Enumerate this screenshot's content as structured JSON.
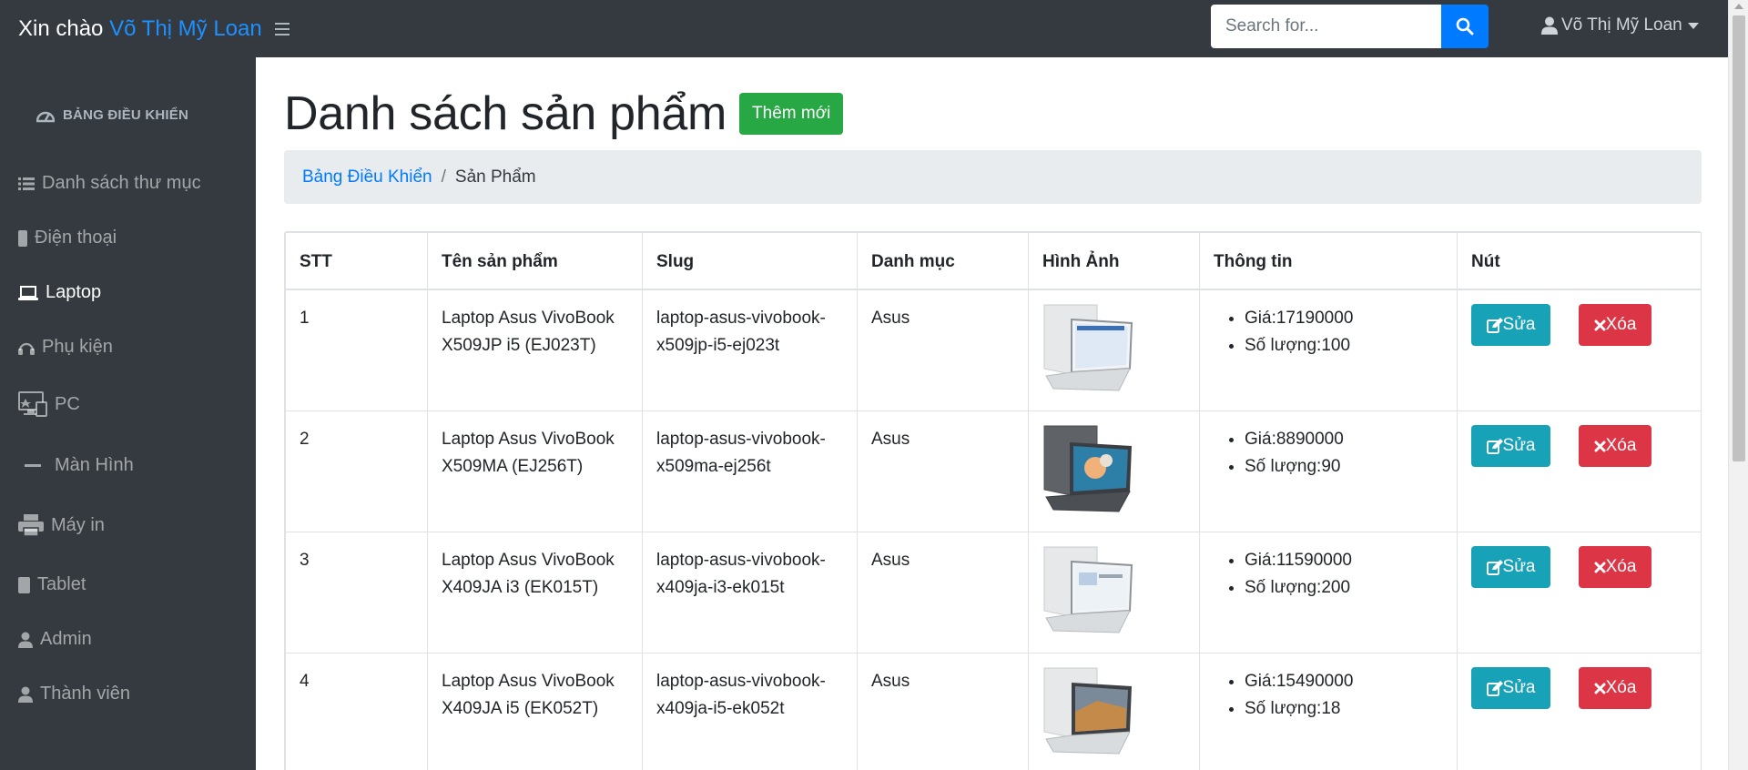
{
  "navbar": {
    "greeting": "Xin chào",
    "user_name": "Võ Thị Mỹ Loan",
    "search_placeholder": "Search for...",
    "user_menu_label": "Võ Thị Mỹ Loan"
  },
  "sidebar": {
    "heading": "BẢNG ĐIỀU KHIỂN",
    "items": [
      {
        "label": "Danh sách thư mục",
        "icon": "list-icon"
      },
      {
        "label": "Điện thoại",
        "icon": "mobile-icon"
      },
      {
        "label": "Laptop",
        "icon": "laptop-icon",
        "active": true
      },
      {
        "label": "Phụ kiện",
        "icon": "headphones-icon"
      },
      {
        "label": "PC",
        "icon": "desktop-icon"
      },
      {
        "label": "Màn Hình",
        "icon": "minus-icon"
      },
      {
        "label": "Máy in",
        "icon": "printer-icon"
      },
      {
        "label": "Tablet",
        "icon": "tablet-icon"
      },
      {
        "label": "Admin",
        "icon": "user-icon"
      },
      {
        "label": "Thành viên",
        "icon": "user-icon"
      }
    ]
  },
  "page": {
    "title": "Danh sách sản phẩm",
    "add_button": "Thêm mới"
  },
  "breadcrumb": {
    "home": "Bảng Điều Khiển",
    "separator": "/",
    "current": "Sản Phẩm"
  },
  "table": {
    "headers": [
      "STT",
      "Tên sản phẩm",
      "Slug",
      "Danh mục",
      "Hình Ảnh",
      "Thông tin",
      "Nút"
    ],
    "rows": [
      {
        "stt": "1",
        "name": "Laptop Asus VivoBook X509JP i5 (EJ023T)",
        "slug": "laptop-asus-vivobook-x509jp-i5-ej023t",
        "category": "Asus",
        "price": "Giá:17190000",
        "qty": "Số lượng:100",
        "edit": "Sửa",
        "delete": "Xóa",
        "image_color": "light-silver"
      },
      {
        "stt": "2",
        "name": "Laptop Asus VivoBook X509MA (EJ256T)",
        "slug": "laptop-asus-vivobook-x509ma-ej256t",
        "category": "Asus",
        "price": "Giá:8890000",
        "qty": "Số lượng:90",
        "edit": "Sửa",
        "delete": "Xóa",
        "image_color": "dark-grey"
      },
      {
        "stt": "3",
        "name": "Laptop Asus VivoBook X409JA i3 (EK015T)",
        "slug": "laptop-asus-vivobook-x409ja-i3-ek015t",
        "category": "Asus",
        "price": "Giá:11590000",
        "qty": "Số lượng:200",
        "edit": "Sửa",
        "delete": "Xóa",
        "image_color": "light-silver"
      },
      {
        "stt": "4",
        "name": "Laptop Asus VivoBook X409JA i5 (EK052T)",
        "slug": "laptop-asus-vivobook-x409ja-i5-ek052t",
        "category": "Asus",
        "price": "Giá:15490000",
        "qty": "Số lượng:18",
        "edit": "Sửa",
        "delete": "Xóa",
        "image_color": "light-silver"
      }
    ]
  },
  "colors": {
    "navbar_bg": "#343a40",
    "primary": "#007bff",
    "success": "#28a745",
    "info": "#17a2b8",
    "danger": "#dc3545"
  }
}
